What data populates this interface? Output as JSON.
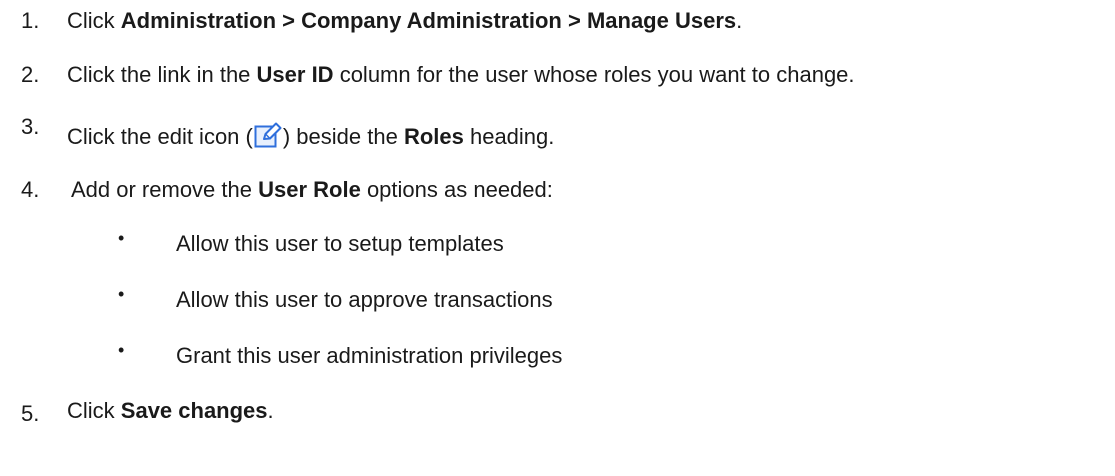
{
  "steps": [
    {
      "number": "1.",
      "click": "Click ",
      "path_a": "Administration",
      "sep1": " > ",
      "path_b": "Company Administration",
      "sep2": " > ",
      "path_c": "Manage Users",
      "end": "."
    },
    {
      "number": "2.",
      "pre": "Click the link in the ",
      "bold": "User ID",
      "post": " column for the user whose roles you want to change."
    },
    {
      "number": "3.",
      "pre": "Click the edit icon (",
      "icon": "edit-icon",
      "mid": ") beside the ",
      "bold": "Roles",
      "post": " heading."
    },
    {
      "number": "4.",
      "pre": "Add or remove the ",
      "bold": "User Role",
      "post": " options as needed:"
    },
    {
      "number": "5.",
      "pre": "Click ",
      "bold": "Save changes",
      "post": "."
    }
  ],
  "options": [
    {
      "bullet": "•",
      "text": "Allow this user to setup templates"
    },
    {
      "bullet": "•",
      "text": "Allow this user to approve transactions"
    },
    {
      "bullet": "•",
      "text": "Grant this user administration privileges"
    }
  ],
  "colors": {
    "text": "#1a1a1a",
    "icon_stroke": "#2f6fdc",
    "icon_fill": "#e8f0fd"
  }
}
